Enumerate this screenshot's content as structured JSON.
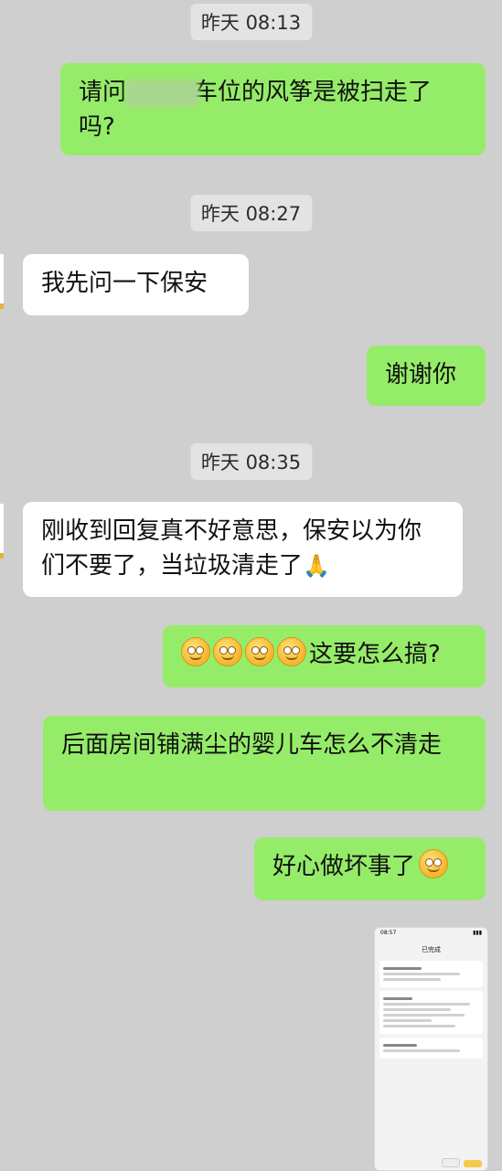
{
  "timestamps": {
    "t1": "昨天 08:13",
    "t2": "昨天 08:27",
    "t3": "昨天 08:35"
  },
  "messages": {
    "m1_part1": "请问",
    "m1_part2": "车位的风筝是被扫走了吗?",
    "m2": "我先问一下保安",
    "m3": "谢谢你",
    "m4_text": "刚收到回复真不好意思，保安以为你们不要了，当垃圾清走了",
    "m4_emoji": "🙏",
    "m5_text": "这要怎么搞?",
    "m6": "后面房间铺满尘的婴儿车怎么不清走",
    "m7_text": "好心做坏事了"
  },
  "thumbnail": {
    "time": "08:57",
    "title": "已完成"
  },
  "colors": {
    "background": "#cfcfcf",
    "outgoing_bubble": "#95ec69",
    "incoming_bubble": "#ffffff",
    "timestamp_bg": "#e3e3e3"
  },
  "icons": {
    "smile_emoji": "smiling-face-icon",
    "ok_hand_emoji": "pinched-hand-icon"
  }
}
